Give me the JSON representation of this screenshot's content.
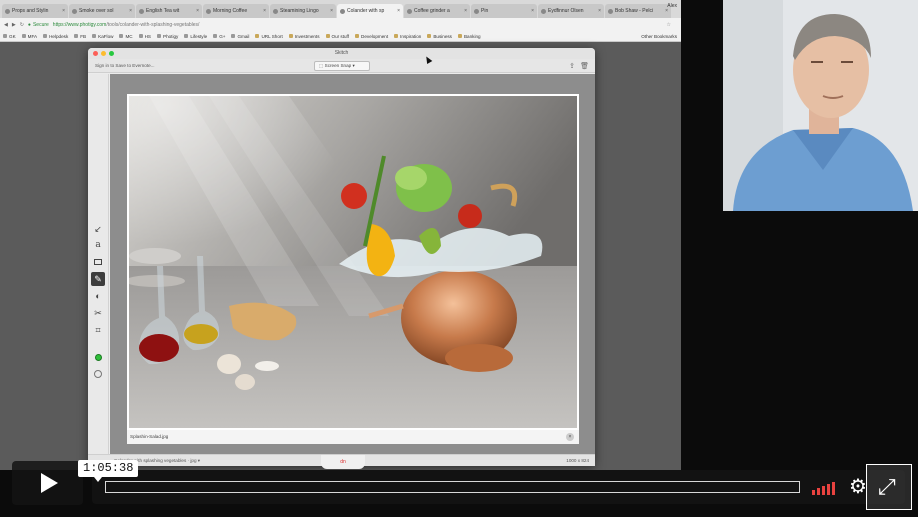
{
  "browser": {
    "tabs": [
      {
        "label": "Props and Stylin"
      },
      {
        "label": "Smoke over sol"
      },
      {
        "label": "English Tea wit"
      },
      {
        "label": "Morning Coffee"
      },
      {
        "label": "Steamining Lingo"
      },
      {
        "label": "Colander with sp"
      },
      {
        "label": "Coffee grinder a"
      },
      {
        "label": "Pin"
      },
      {
        "label": "Eydfinnur Olsen"
      },
      {
        "label": "Bob Shaw - Pelci"
      }
    ],
    "user": "Alex",
    "secure_label": "Secure",
    "url_host": "https://www.photigy.com",
    "url_path": "/tools/colander-with-splashing-vegetables/",
    "bookmarks": [
      "GK",
      "MFA",
      "Helpdesk",
      "FB",
      "KaFlow",
      "MC",
      "HS",
      "Photigy",
      "Lifestyle",
      "G+",
      "Gmail",
      "URL Short",
      "Investments",
      "Our stuff",
      "Development",
      "Inspiration",
      "Business",
      "Banking"
    ],
    "other_bookmarks": "Other Bookmarks"
  },
  "skitch": {
    "title": "Skitch",
    "signin": "Sign in to Save to Evernote...",
    "mode": "Screen Snap",
    "filename": "Splashin-Salad.jpg",
    "status_text": "Colander with splashing vegetables",
    "status_format": "jpg",
    "dims": "1000 x 824",
    "tools": [
      "arrow-tool",
      "text-tool",
      "rectangle-tool",
      "pen-tool",
      "stamp-tool",
      "pixelate-tool",
      "crop-tool",
      "color-picker",
      "size-picker"
    ],
    "drag_label": "dn"
  },
  "player": {
    "time": "1:05:38",
    "progress": 0.0,
    "volume_level": 1.0
  },
  "colors": {
    "accent": "#e8423f",
    "skitch_green": "#2fbf3a"
  }
}
